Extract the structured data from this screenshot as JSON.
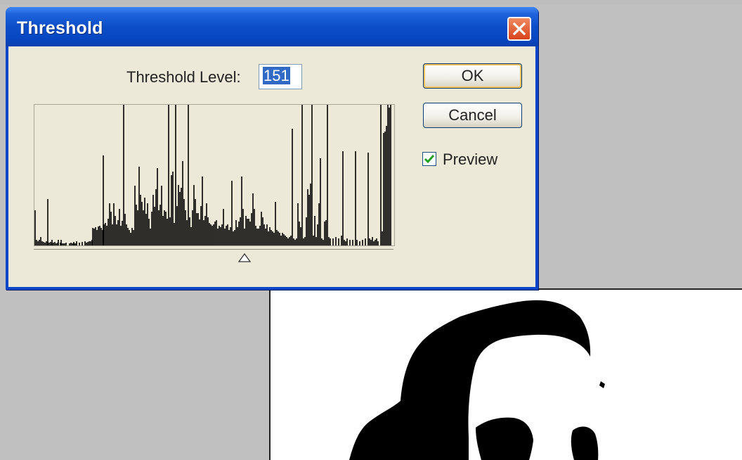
{
  "dialog": {
    "title": "Threshold",
    "level_label": "Threshold Level:",
    "level_value": "151",
    "ok_label": "OK",
    "cancel_label": "Cancel",
    "preview_label": "Preview",
    "preview_checked": true,
    "close_icon": "close-icon"
  },
  "histogram": {
    "max_value": 255,
    "slider_value": 151,
    "bars": [
      [
        1,
        50
      ],
      [
        3,
        8
      ],
      [
        5,
        6
      ],
      [
        7,
        8
      ],
      [
        9,
        12
      ],
      [
        11,
        6
      ],
      [
        13,
        5
      ],
      [
        15,
        4
      ],
      [
        17,
        6
      ],
      [
        19,
        5
      ],
      [
        21,
        4
      ],
      [
        23,
        5
      ],
      [
        25,
        3
      ],
      [
        27,
        4
      ],
      [
        29,
        5
      ],
      [
        31,
        3
      ],
      [
        33,
        4
      ],
      [
        37,
        4
      ],
      [
        39,
        3
      ],
      [
        41,
        3
      ],
      [
        43,
        3
      ],
      [
        45,
        4
      ],
      [
        19,
        66
      ],
      [
        25,
        8
      ],
      [
        34,
        8
      ],
      [
        38,
        8
      ],
      [
        50,
        3
      ],
      [
        52,
        4
      ],
      [
        54,
        3
      ],
      [
        56,
        4
      ],
      [
        58,
        3
      ],
      [
        60,
        3
      ],
      [
        56,
        5
      ],
      [
        60,
        6
      ],
      [
        64,
        4
      ],
      [
        68,
        5
      ],
      [
        72,
        6
      ],
      [
        74,
        4
      ],
      [
        76,
        5
      ],
      [
        78,
        6
      ],
      [
        80,
        6
      ],
      [
        82,
        8
      ],
      [
        83,
        25
      ],
      [
        85,
        24
      ],
      [
        87,
        26
      ],
      [
        89,
        22
      ],
      [
        91,
        27
      ],
      [
        93,
        28
      ],
      [
        95,
        25
      ],
      [
        97,
        22
      ],
      [
        98,
        128
      ],
      [
        99,
        30
      ],
      [
        101,
        32
      ],
      [
        103,
        28
      ],
      [
        105,
        38
      ],
      [
        107,
        60
      ],
      [
        109,
        48
      ],
      [
        111,
        30
      ],
      [
        113,
        60
      ],
      [
        115,
        42
      ],
      [
        117,
        30
      ],
      [
        119,
        36
      ],
      [
        121,
        52
      ],
      [
        123,
        28
      ],
      [
        125,
        35
      ],
      [
        127,
        200
      ],
      [
        129,
        45
      ],
      [
        131,
        30
      ],
      [
        133,
        25
      ],
      [
        135,
        22
      ],
      [
        137,
        18
      ],
      [
        139,
        25
      ],
      [
        141,
        22
      ],
      [
        143,
        85
      ],
      [
        145,
        58
      ],
      [
        147,
        50
      ],
      [
        149,
        112
      ],
      [
        151,
        72
      ],
      [
        153,
        62
      ],
      [
        155,
        50
      ],
      [
        157,
        68
      ],
      [
        159,
        45
      ],
      [
        161,
        60
      ],
      [
        163,
        38
      ],
      [
        165,
        24
      ],
      [
        167,
        48
      ],
      [
        169,
        72
      ],
      [
        171,
        55
      ],
      [
        173,
        80
      ],
      [
        175,
        110
      ],
      [
        177,
        50
      ],
      [
        179,
        58
      ],
      [
        181,
        85
      ],
      [
        183,
        42
      ],
      [
        185,
        50
      ],
      [
        187,
        48
      ],
      [
        189,
        38
      ],
      [
        191,
        200
      ],
      [
        193,
        40
      ],
      [
        195,
        100
      ],
      [
        197,
        105
      ],
      [
        199,
        32
      ],
      [
        201,
        200
      ],
      [
        203,
        56
      ],
      [
        205,
        86
      ],
      [
        207,
        76
      ],
      [
        209,
        82
      ],
      [
        211,
        120
      ],
      [
        213,
        66
      ],
      [
        215,
        50
      ],
      [
        217,
        36
      ],
      [
        219,
        200
      ],
      [
        221,
        40
      ],
      [
        223,
        26
      ],
      [
        225,
        50
      ],
      [
        227,
        86
      ],
      [
        229,
        66
      ],
      [
        231,
        46
      ],
      [
        233,
        46
      ],
      [
        235,
        37
      ],
      [
        237,
        56
      ],
      [
        239,
        98
      ],
      [
        241,
        36
      ],
      [
        243,
        42
      ],
      [
        245,
        60
      ],
      [
        247,
        40
      ],
      [
        249,
        32
      ],
      [
        251,
        30
      ],
      [
        253,
        28
      ],
      [
        255,
        30
      ],
      [
        257,
        34
      ],
      [
        259,
        36
      ],
      [
        261,
        24
      ],
      [
        263,
        28
      ],
      [
        265,
        26
      ],
      [
        267,
        30
      ],
      [
        269,
        52
      ],
      [
        271,
        24
      ],
      [
        273,
        28
      ],
      [
        275,
        30
      ],
      [
        277,
        22
      ],
      [
        279,
        26
      ],
      [
        281,
        92
      ],
      [
        283,
        20
      ],
      [
        285,
        22
      ],
      [
        287,
        36
      ],
      [
        289,
        26
      ],
      [
        291,
        34
      ],
      [
        293,
        40
      ],
      [
        295,
        98
      ],
      [
        297,
        52
      ],
      [
        299,
        24
      ],
      [
        301,
        42
      ],
      [
        303,
        38
      ],
      [
        305,
        38
      ],
      [
        307,
        34
      ],
      [
        309,
        46
      ],
      [
        311,
        74
      ],
      [
        313,
        52
      ],
      [
        315,
        28
      ],
      [
        317,
        24
      ],
      [
        319,
        24
      ],
      [
        321,
        28
      ],
      [
        323,
        48
      ],
      [
        325,
        40
      ],
      [
        327,
        30
      ],
      [
        329,
        24
      ],
      [
        331,
        30
      ],
      [
        333,
        20
      ],
      [
        335,
        26
      ],
      [
        337,
        22
      ],
      [
        339,
        20
      ],
      [
        341,
        18
      ],
      [
        343,
        62
      ],
      [
        345,
        22
      ],
      [
        347,
        20
      ],
      [
        349,
        18
      ],
      [
        351,
        14
      ],
      [
        353,
        18
      ],
      [
        355,
        16
      ],
      [
        357,
        14
      ],
      [
        359,
        12
      ],
      [
        361,
        10
      ],
      [
        363,
        12
      ],
      [
        365,
        14
      ],
      [
        367,
        166
      ],
      [
        369,
        10
      ],
      [
        371,
        8
      ],
      [
        373,
        10
      ],
      [
        375,
        60
      ],
      [
        377,
        34
      ],
      [
        379,
        26
      ],
      [
        381,
        200
      ],
      [
        383,
        10
      ],
      [
        385,
        12
      ],
      [
        387,
        40
      ],
      [
        389,
        80
      ],
      [
        391,
        72
      ],
      [
        393,
        88
      ],
      [
        395,
        200
      ],
      [
        397,
        14
      ],
      [
        399,
        42
      ],
      [
        401,
        12
      ],
      [
        403,
        30
      ],
      [
        405,
        60
      ],
      [
        407,
        124
      ],
      [
        409,
        10
      ],
      [
        411,
        8
      ],
      [
        413,
        34
      ],
      [
        415,
        36
      ],
      [
        417,
        200
      ],
      [
        419,
        12
      ],
      [
        421,
        10
      ],
      [
        425,
        10
      ],
      [
        429,
        12
      ],
      [
        433,
        10
      ],
      [
        437,
        14
      ],
      [
        439,
        134
      ],
      [
        441,
        8
      ],
      [
        443,
        6
      ],
      [
        445,
        10
      ],
      [
        449,
        8
      ],
      [
        453,
        8
      ],
      [
        457,
        134
      ],
      [
        459,
        8
      ],
      [
        463,
        6
      ],
      [
        467,
        8
      ],
      [
        471,
        10
      ],
      [
        475,
        132
      ],
      [
        477,
        10
      ],
      [
        479,
        8
      ],
      [
        481,
        12
      ],
      [
        483,
        6
      ],
      [
        485,
        8
      ],
      [
        487,
        10
      ],
      [
        489,
        6
      ],
      [
        493,
        200
      ],
      [
        495,
        20
      ],
      [
        497,
        160
      ],
      [
        499,
        162
      ],
      [
        501,
        170
      ],
      [
        503,
        200
      ],
      [
        505,
        196
      ],
      [
        507,
        200
      ]
    ]
  }
}
